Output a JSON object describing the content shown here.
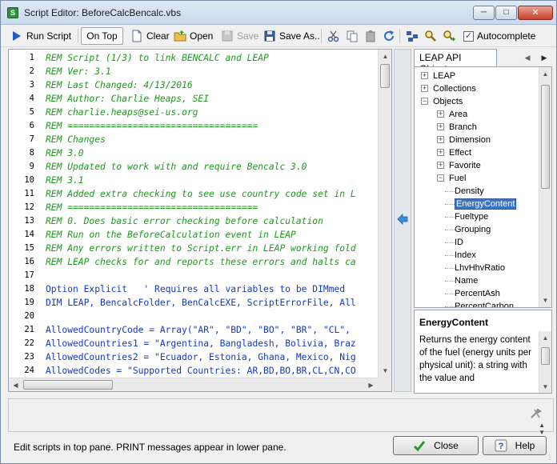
{
  "window": {
    "title": "Script Editor: BeforeCalcBencalc.vbs",
    "controls": [
      "minimize",
      "maximize",
      "close"
    ]
  },
  "toolbar": {
    "run_script": "Run Script",
    "on_top": "On Top",
    "clear": "Clear",
    "open": "Open",
    "save": "Save",
    "save_as": "Save As..",
    "autocomplete": "Autocomplete",
    "autocomplete_checked": true,
    "check_mark": "✓"
  },
  "editor": {
    "lines": [
      {
        "n": "1",
        "type": "comment",
        "text": "REM Script (1/3) to link BENCALC and LEAP"
      },
      {
        "n": "2",
        "type": "comment",
        "text": "REM Ver: 3.1"
      },
      {
        "n": "3",
        "type": "comment",
        "text": "REM Last Changed: 4/13/2016"
      },
      {
        "n": "4",
        "type": "comment",
        "text": "REM Author: Charlie Heaps, SEI"
      },
      {
        "n": "5",
        "type": "comment",
        "text": "REM charlie.heaps@sei-us.org"
      },
      {
        "n": "6",
        "type": "comment",
        "text": "REM ==================================="
      },
      {
        "n": "7",
        "type": "comment",
        "text": "REM Changes"
      },
      {
        "n": "8",
        "type": "comment",
        "text": "REM 3.0"
      },
      {
        "n": "9",
        "type": "comment",
        "text": "REM Updated to work with and require Bencalc 3.0"
      },
      {
        "n": "10",
        "type": "comment",
        "text": "REM 3.1"
      },
      {
        "n": "11",
        "type": "comment",
        "text": "REM Added extra checking to see use country code set in L"
      },
      {
        "n": "12",
        "type": "comment",
        "text": "REM ==================================="
      },
      {
        "n": "13",
        "type": "comment",
        "text": "REM 0. Does basic error checking before calculation"
      },
      {
        "n": "14",
        "type": "comment",
        "text": "REM Run on the BeforeCalculation event in LEAP"
      },
      {
        "n": "15",
        "type": "comment",
        "text": "REM Any errors written to Script.err in LEAP working fold"
      },
      {
        "n": "16",
        "type": "comment",
        "text": "REM LEAP checks for and reports these errors and halts ca"
      },
      {
        "n": "17",
        "type": "code",
        "text": ""
      },
      {
        "n": "18",
        "type": "code",
        "text": "Option Explicit   ' Requires all variables to be DIMmed"
      },
      {
        "n": "19",
        "type": "code",
        "text": "DIM LEAP, BencalcFolder, BenCalcEXE, ScriptErrorFile, All"
      },
      {
        "n": "20",
        "type": "code",
        "text": ""
      },
      {
        "n": "21",
        "type": "code",
        "text": "AllowedCountryCode = Array(\"AR\", \"BD\", \"BO\", \"BR\", \"CL\","
      },
      {
        "n": "22",
        "type": "code",
        "text": "AllowedCountries1 = \"Argentina, Bangladesh, Bolivia, Braz"
      },
      {
        "n": "23",
        "type": "code",
        "text": "AllowedCountries2 = \"Ecuador, Estonia, Ghana, Mexico, Nig"
      },
      {
        "n": "24",
        "type": "code",
        "text": "AllowedCodes = \"Supported Countries: AR,BD,BO,BR,CL,CN,CO"
      }
    ]
  },
  "api_panel": {
    "tab_label": "LEAP API Objects",
    "tree": [
      {
        "label": "LEAP",
        "depth": 0,
        "expander": "+"
      },
      {
        "label": "Collections",
        "depth": 0,
        "expander": "+"
      },
      {
        "label": "Objects",
        "depth": 0,
        "expander": "−"
      },
      {
        "label": "Area",
        "depth": 1,
        "expander": "+"
      },
      {
        "label": "Branch",
        "depth": 1,
        "expander": "+"
      },
      {
        "label": "Dimension",
        "depth": 1,
        "expander": "+"
      },
      {
        "label": "Effect",
        "depth": 1,
        "expander": "+"
      },
      {
        "label": "Favorite",
        "depth": 1,
        "expander": "+"
      },
      {
        "label": "Fuel",
        "depth": 1,
        "expander": "−"
      },
      {
        "label": "Density",
        "depth": 2,
        "expander": ""
      },
      {
        "label": "EnergyContent",
        "depth": 2,
        "expander": "",
        "selected": true
      },
      {
        "label": "Fueltype",
        "depth": 2,
        "expander": ""
      },
      {
        "label": "Grouping",
        "depth": 2,
        "expander": ""
      },
      {
        "label": "ID",
        "depth": 2,
        "expander": ""
      },
      {
        "label": "Index",
        "depth": 2,
        "expander": ""
      },
      {
        "label": "LhvHhvRatio",
        "depth": 2,
        "expander": ""
      },
      {
        "label": "Name",
        "depth": 2,
        "expander": ""
      },
      {
        "label": "PercentAsh",
        "depth": 2,
        "expander": ""
      },
      {
        "label": "PercentCarbon",
        "depth": 2,
        "expander": ""
      }
    ],
    "help_title": "EnergyContent",
    "help_text": "Returns the energy content of the fuel (energy units per physical unit): a string with the value and"
  },
  "status": {
    "message": "Edit scripts in top pane.  PRINT messages appear in lower pane.",
    "close_button": "Close",
    "help_button": "Help"
  }
}
